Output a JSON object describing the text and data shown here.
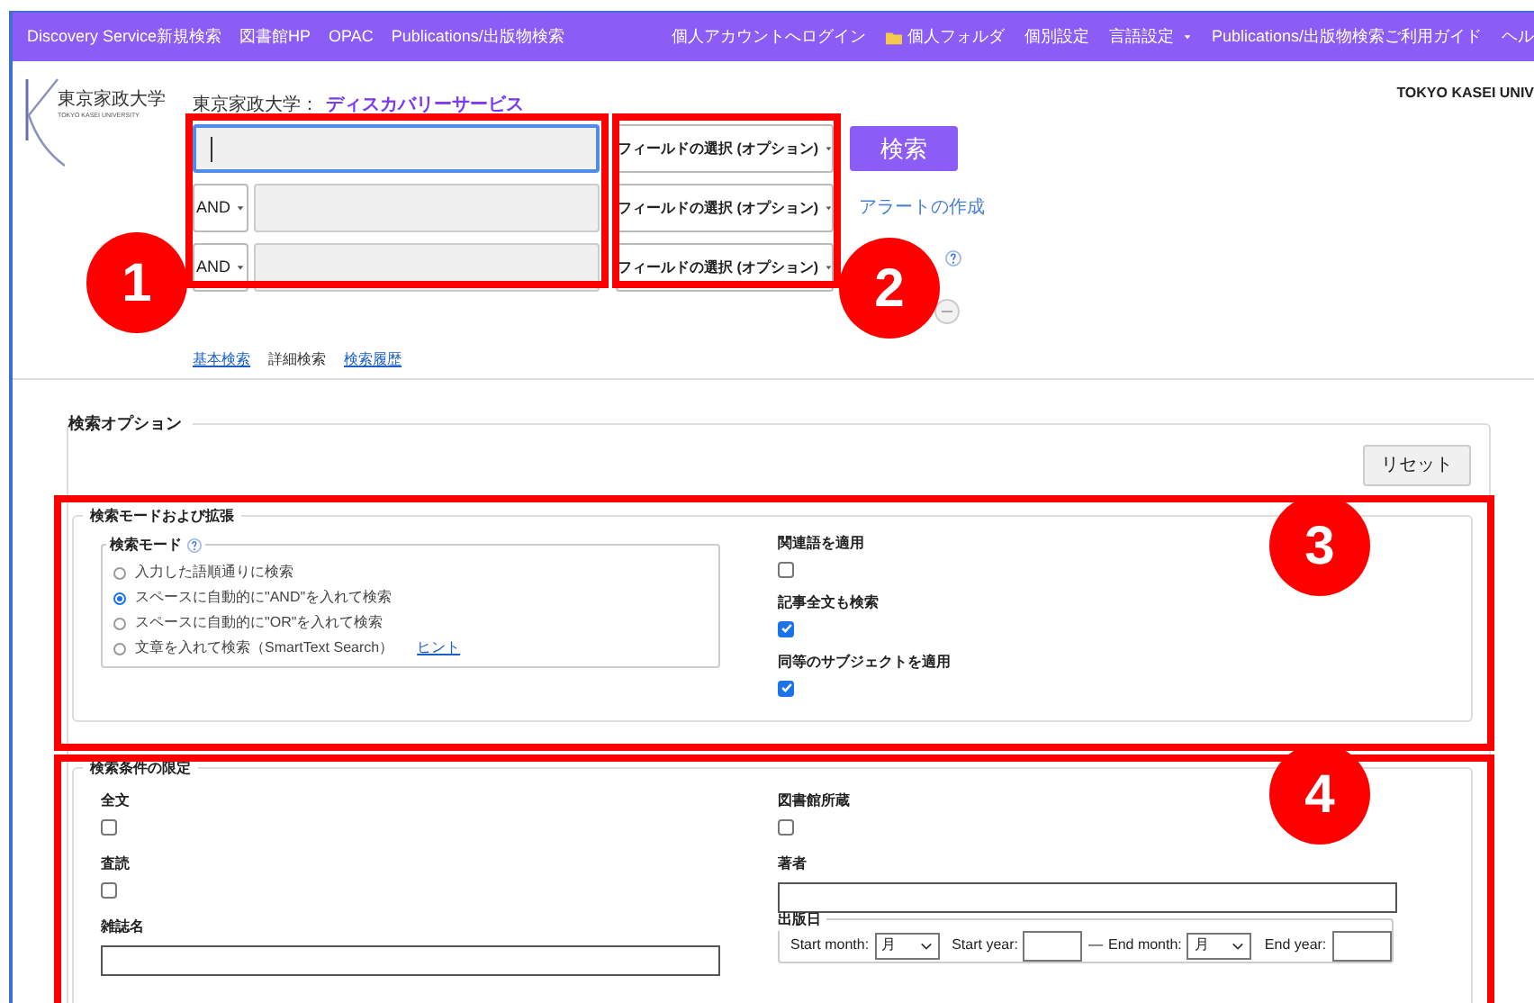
{
  "nav": {
    "left": [
      "Discovery Service新規検索",
      "図書館HP",
      "OPAC",
      "Publications/出版物検索"
    ],
    "right": [
      {
        "label": "個人アカウントへログイン",
        "kind": "link"
      },
      {
        "label": "個人フォルダ",
        "kind": "folder"
      },
      {
        "label": "個別設定",
        "kind": "link"
      },
      {
        "label": "言語設定",
        "kind": "menu"
      },
      {
        "label": "Publications/出版物検索ご利用ガイド",
        "kind": "link"
      },
      {
        "label": "ヘル",
        "kind": "link"
      }
    ]
  },
  "header": {
    "logo_text": "東京家政大学",
    "logo_subtext": "TOKYO KASEI UNIVERSITY",
    "breadcrumb_prefix": "東京家政大学：",
    "breadcrumb_title": "ディスカバリーサービス",
    "org_name": "TOKYO KASEI UNIV"
  },
  "search_rows": [
    {
      "field": "フィールドの選択 (オプション)",
      "focused": true
    },
    {
      "operator": "AND",
      "field": "フィールドの選択 (オプション)",
      "focused": false
    },
    {
      "operator": "AND",
      "field": "フィールドの選択 (オプション)",
      "focused": false
    }
  ],
  "search_button": "検索",
  "alert_link": "アラートの作成",
  "search_tabs": [
    {
      "label": "基本検索",
      "selected": false
    },
    {
      "label": "詳細検索",
      "selected": true
    },
    {
      "label": "検索履歴",
      "selected": false
    }
  ],
  "options": {
    "title": "検索オプション",
    "reset": "リセット",
    "modes": {
      "title": "検索モードおよび拡張",
      "mode_title": "検索モード",
      "mode_options": [
        {
          "label": "入力した語順通りに検索",
          "selected": false
        },
        {
          "label": "スペースに自動的に\"AND\"を入れて検索",
          "selected": true
        },
        {
          "label": "スペースに自動的に\"OR\"を入れて検索",
          "selected": false
        },
        {
          "label": "文章を入れて検索（SmartText Search）",
          "selected": false,
          "hint": "ヒント"
        }
      ],
      "expanders": [
        {
          "label": "関連語を適用",
          "checked": false
        },
        {
          "label": "記事全文も検索",
          "checked": true
        },
        {
          "label": "同等のサブジェクトを適用",
          "checked": true
        }
      ]
    },
    "limits": {
      "title": "検索条件の限定",
      "left": [
        {
          "kind": "checkbox",
          "label": "全文",
          "checked": false
        },
        {
          "kind": "checkbox",
          "label": "査読",
          "checked": false
        },
        {
          "kind": "text",
          "label": "雑誌名"
        }
      ],
      "right": [
        {
          "kind": "checkbox",
          "label": "図書館所蔵",
          "checked": false
        },
        {
          "kind": "text",
          "label": "著者"
        },
        {
          "kind": "date",
          "label": "出版日",
          "start_month_label": "Start month:",
          "start_month_value": "月",
          "start_year_label": "Start year:",
          "separator": "—",
          "end_month_label": "End month:",
          "end_month_value": "月",
          "end_year_label": "End year:"
        }
      ]
    }
  },
  "annotations": [
    {
      "number": "1"
    },
    {
      "number": "2"
    },
    {
      "number": "3"
    },
    {
      "number": "4"
    }
  ]
}
